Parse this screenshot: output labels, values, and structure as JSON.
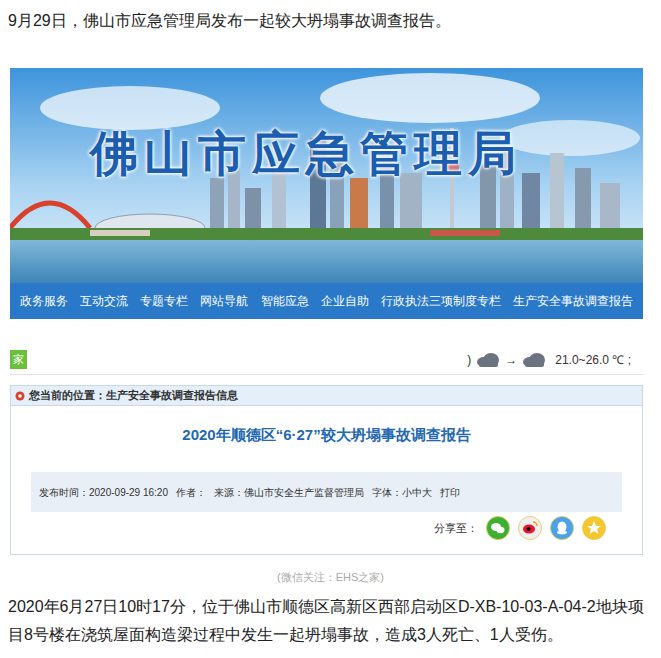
{
  "intro": "9月29日，佛山市应急管理局发布一起较大坍塌事故调查报告。",
  "site": {
    "title": "佛山市应急管理局",
    "nav": [
      "政务服务",
      "互动交流",
      "专题专栏",
      "网站导航",
      "智能应急",
      "企业自助",
      "行政执法三项制度专栏",
      "生产安全事故调查报告"
    ],
    "home_tab": "家",
    "weather": {
      "prefix": ")",
      "arrow": "→",
      "temp": "21.0~26.0 ℃ ;"
    }
  },
  "article": {
    "breadcrumb": "您当前的位置：生产安全事故调查报告信息",
    "title": "2020年顺德区“6·27”较大坍塌事故调查报告",
    "meta": [
      "发布时间：2020-09-29 16:20",
      "作者：",
      "来源：佛山市安全生产监督管理局",
      "字体：小中大",
      "打印"
    ],
    "share_label": "分享至：",
    "share": [
      {
        "kind": "wechat",
        "color": "#3cb034"
      },
      {
        "kind": "weibo",
        "color": "#f0f0f0"
      },
      {
        "kind": "qq",
        "color": "#4aa3e8"
      },
      {
        "kind": "qzone",
        "color": "#f6c62f"
      }
    ]
  },
  "caption": "(微信关注：EHS之家)",
  "paragraph": "2020年6月27日10时17分，位于佛山市顺德区高新区西部启动区D-XB-10-03-A-04-2地块项目8号楼在浇筑屋面构造梁过程中发生一起坍塌事故，造成3人死亡、1人受伤。"
}
